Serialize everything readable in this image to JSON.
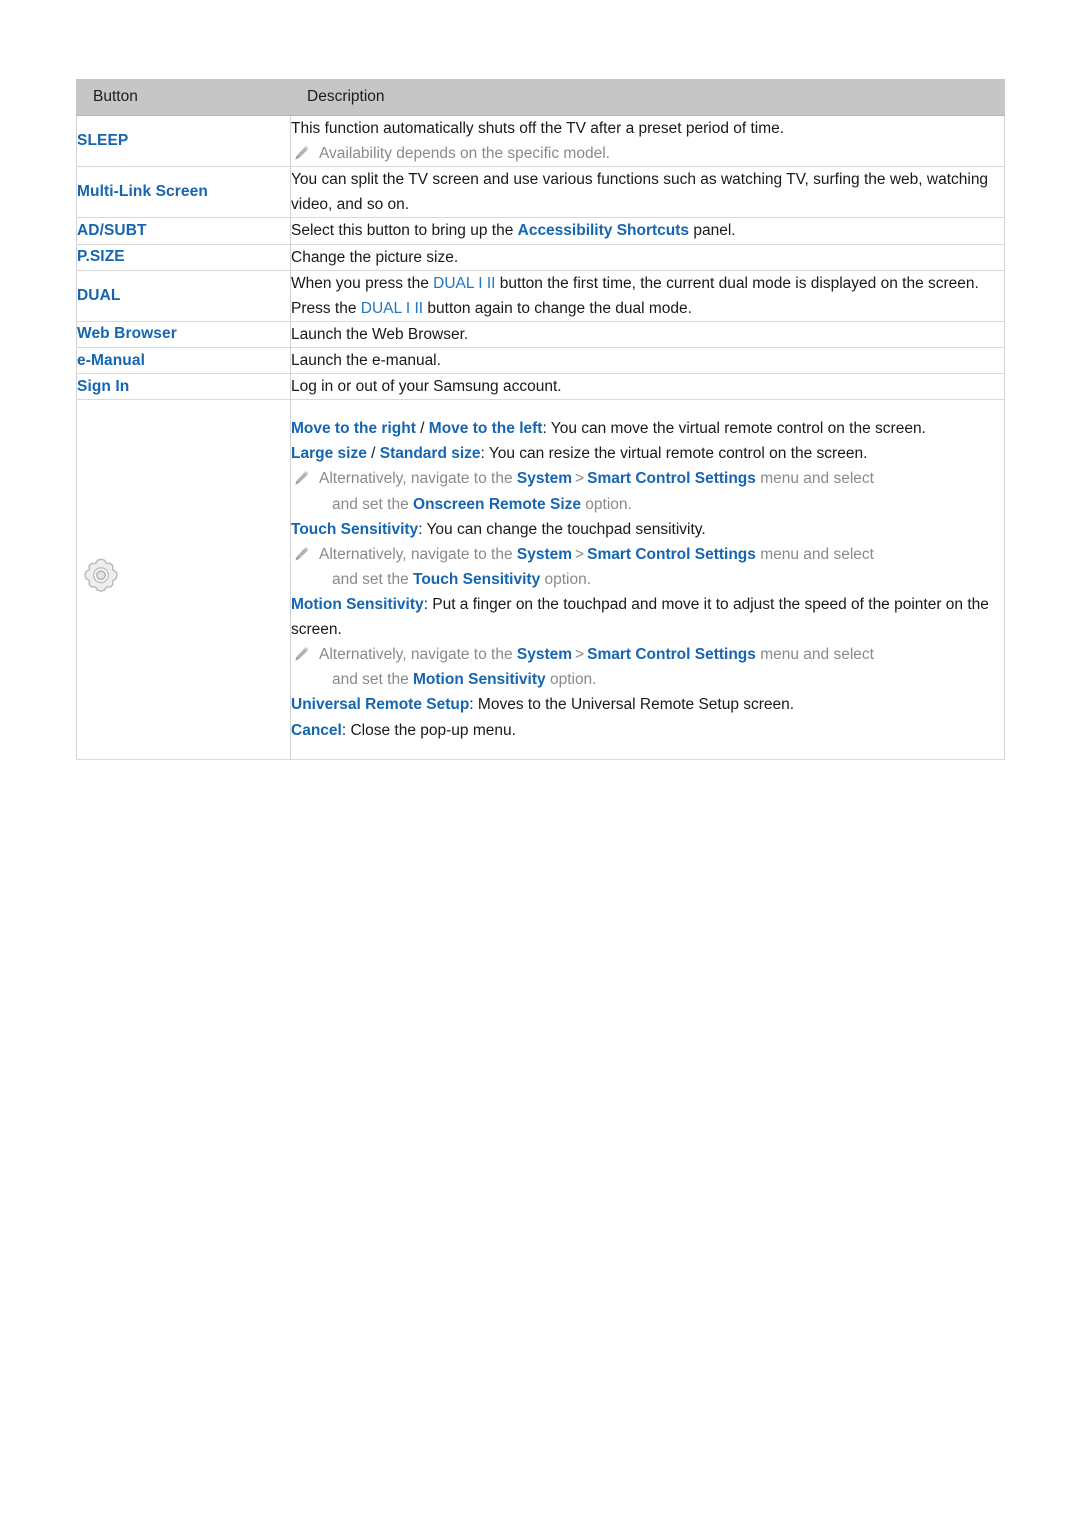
{
  "colors": {
    "accent_blue": "#1565b0",
    "accent_blue_light": "#2176bd",
    "header_bg": "#c6c6c6",
    "note_gray": "#8a8a8a",
    "body_text": "#1a1a1a",
    "border": "#d9d9d9"
  },
  "table": {
    "headers": {
      "button": "Button",
      "description": "Description"
    },
    "rows": [
      {
        "button": "SLEEP",
        "button_icon": null,
        "desc_lines": [
          {
            "type": "text",
            "parts": [
              {
                "t": "This function automatically shuts off the TV after a preset period of time."
              }
            ]
          },
          {
            "type": "note",
            "parts": [
              {
                "t": "Availability depends on the specific model."
              }
            ]
          }
        ]
      },
      {
        "button": "Multi-Link Screen",
        "button_icon": null,
        "desc_lines": [
          {
            "type": "text",
            "parts": [
              {
                "t": "You can split the TV screen and use various functions such as watching TV, surfing the web, watching video, and so on."
              }
            ]
          }
        ]
      },
      {
        "button": "AD/SUBT",
        "button_icon": null,
        "desc_lines": [
          {
            "type": "text",
            "parts": [
              {
                "t": "Select this button to bring up the "
              },
              {
                "t": "Accessibility Shortcuts",
                "s": "b"
              },
              {
                "t": " panel."
              }
            ]
          }
        ]
      },
      {
        "button": "P.SIZE",
        "button_icon": null,
        "desc_lines": [
          {
            "type": "text",
            "parts": [
              {
                "t": "Change the picture size."
              }
            ]
          }
        ]
      },
      {
        "button": "DUAL",
        "button_icon": null,
        "desc_lines": [
          {
            "type": "text",
            "parts": [
              {
                "t": "When you press the "
              },
              {
                "t": "DUAL I II",
                "s": "b-light"
              },
              {
                "t": " button the first time, the current dual mode is displayed on the screen."
              }
            ]
          },
          {
            "type": "text",
            "parts": [
              {
                "t": "Press the "
              },
              {
                "t": "DUAL I II",
                "s": "b-light"
              },
              {
                "t": " button again to change the dual mode."
              }
            ]
          }
        ]
      },
      {
        "button": "Web Browser",
        "button_icon": null,
        "desc_lines": [
          {
            "type": "text",
            "parts": [
              {
                "t": "Launch the Web Browser."
              }
            ]
          }
        ]
      },
      {
        "button": "e-Manual",
        "button_icon": null,
        "desc_lines": [
          {
            "type": "text",
            "parts": [
              {
                "t": "Launch the e-manual."
              }
            ]
          }
        ]
      },
      {
        "button": "Sign In",
        "button_icon": null,
        "desc_lines": [
          {
            "type": "text",
            "parts": [
              {
                "t": "Log in or out of your Samsung account."
              }
            ]
          }
        ]
      },
      {
        "button": "",
        "button_icon": "gear-icon",
        "desc_lines": [
          {
            "type": "text",
            "parts": [
              {
                "t": "Move to the right",
                "s": "b"
              },
              {
                "t": " / ",
                "s": "sep"
              },
              {
                "t": "Move to the left",
                "s": "b"
              },
              {
                "t": ": You can move the virtual remote control on the screen."
              }
            ]
          },
          {
            "type": "text",
            "parts": [
              {
                "t": "Large size",
                "s": "b"
              },
              {
                "t": " / ",
                "s": "sep"
              },
              {
                "t": "Standard size",
                "s": "b"
              },
              {
                "t": ": You can resize the virtual remote control on the screen."
              }
            ]
          },
          {
            "type": "note",
            "parts": [
              {
                "t": "Alternatively, navigate to the "
              },
              {
                "t": "System",
                "s": "b"
              },
              {
                "t": ">",
                "s": "chev"
              },
              {
                "t": "Smart Control Settings",
                "s": "b"
              },
              {
                "t": " menu and select"
              }
            ]
          },
          {
            "type": "note-cont",
            "parts": [
              {
                "t": "and set the "
              },
              {
                "t": "Onscreen Remote Size",
                "s": "b"
              },
              {
                "t": " option."
              }
            ]
          },
          {
            "type": "text",
            "parts": [
              {
                "t": "Touch Sensitivity",
                "s": "b"
              },
              {
                "t": ": You can change the touchpad sensitivity."
              }
            ]
          },
          {
            "type": "note",
            "parts": [
              {
                "t": "Alternatively, navigate to the "
              },
              {
                "t": "System",
                "s": "b"
              },
              {
                "t": ">",
                "s": "chev"
              },
              {
                "t": "Smart Control Settings",
                "s": "b"
              },
              {
                "t": " menu and select"
              }
            ]
          },
          {
            "type": "note-cont",
            "parts": [
              {
                "t": "and set the "
              },
              {
                "t": "Touch Sensitivity",
                "s": "b"
              },
              {
                "t": " option."
              }
            ]
          },
          {
            "type": "text",
            "parts": [
              {
                "t": "Motion Sensitivity",
                "s": "b"
              },
              {
                "t": ": Put a finger on the touchpad and move it to adjust the speed of the pointer on the screen."
              }
            ]
          },
          {
            "type": "note",
            "parts": [
              {
                "t": "Alternatively, navigate to the "
              },
              {
                "t": "System",
                "s": "b"
              },
              {
                "t": ">",
                "s": "chev"
              },
              {
                "t": "Smart Control Settings",
                "s": "b"
              },
              {
                "t": " menu and select"
              }
            ]
          },
          {
            "type": "note-cont",
            "parts": [
              {
                "t": "and set the "
              },
              {
                "t": "Motion Sensitivity",
                "s": "b"
              },
              {
                "t": " option."
              }
            ]
          },
          {
            "type": "text",
            "parts": [
              {
                "t": "Universal Remote Setup",
                "s": "b"
              },
              {
                "t": ": Moves to the Universal Remote Setup screen."
              }
            ]
          },
          {
            "type": "text",
            "parts": [
              {
                "t": "Cancel",
                "s": "b"
              },
              {
                "t": ": Close the pop-up menu."
              }
            ]
          }
        ]
      }
    ]
  }
}
